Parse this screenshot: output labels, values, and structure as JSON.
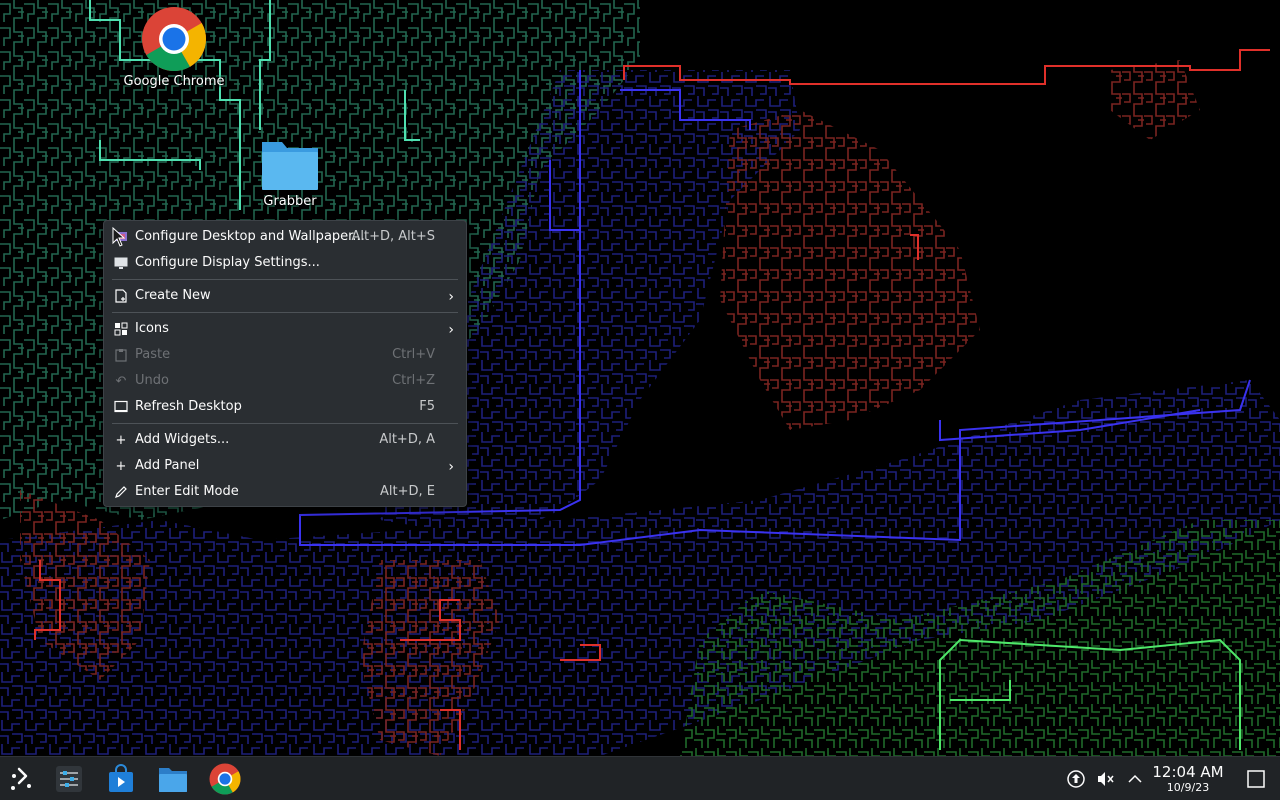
{
  "desktop": {
    "icons": [
      {
        "label": "Google Chrome",
        "icon": "chrome-icon"
      },
      {
        "label": "Grabber",
        "icon": "folder-icon"
      }
    ]
  },
  "context_menu": {
    "items": [
      {
        "label": "Configure Desktop and Wallpaper...",
        "shortcut": "Alt+D, Alt+S",
        "icon": "configure-desktop-icon",
        "enabled": true
      },
      {
        "label": "Configure Display Settings...",
        "shortcut": "",
        "icon": "display-icon",
        "enabled": true
      },
      {
        "label": "Create New",
        "shortcut": "",
        "icon": "create-new-icon",
        "enabled": true,
        "submenu": true
      },
      {
        "label": "Icons",
        "shortcut": "",
        "icon": "icons-grid-icon",
        "enabled": true,
        "submenu": true
      },
      {
        "label": "Paste",
        "shortcut": "Ctrl+V",
        "icon": "paste-icon",
        "enabled": false
      },
      {
        "label": "Undo",
        "shortcut": "Ctrl+Z",
        "icon": "undo-icon",
        "enabled": false
      },
      {
        "label": "Refresh Desktop",
        "shortcut": "F5",
        "icon": "refresh-icon",
        "enabled": true
      },
      {
        "label": "Add Widgets...",
        "shortcut": "Alt+D, A",
        "icon": "plus-icon",
        "enabled": true
      },
      {
        "label": "Add Panel",
        "shortcut": "",
        "icon": "plus-icon",
        "enabled": true,
        "submenu": true
      },
      {
        "label": "Enter Edit Mode",
        "shortcut": "Alt+D, E",
        "icon": "edit-icon",
        "enabled": true
      }
    ]
  },
  "taskbar": {
    "launchers": [
      "app-launcher-icon",
      "system-settings-icon",
      "discover-icon",
      "file-manager-icon",
      "chrome-icon"
    ],
    "tray": [
      "update-icon",
      "volume-muted-icon",
      "expand-tray-icon"
    ],
    "clock": {
      "time": "12:04 AM",
      "date": "10/9/23"
    }
  },
  "colors": {
    "menu_bg": "#2a2e32",
    "taskbar_bg": "#202326",
    "wallpaper_bg": "#000000",
    "maze_teal": "#2e8a6e",
    "maze_blue": "#2a2ed6",
    "maze_red": "#b8322c",
    "maze_green": "#3cb84a"
  }
}
